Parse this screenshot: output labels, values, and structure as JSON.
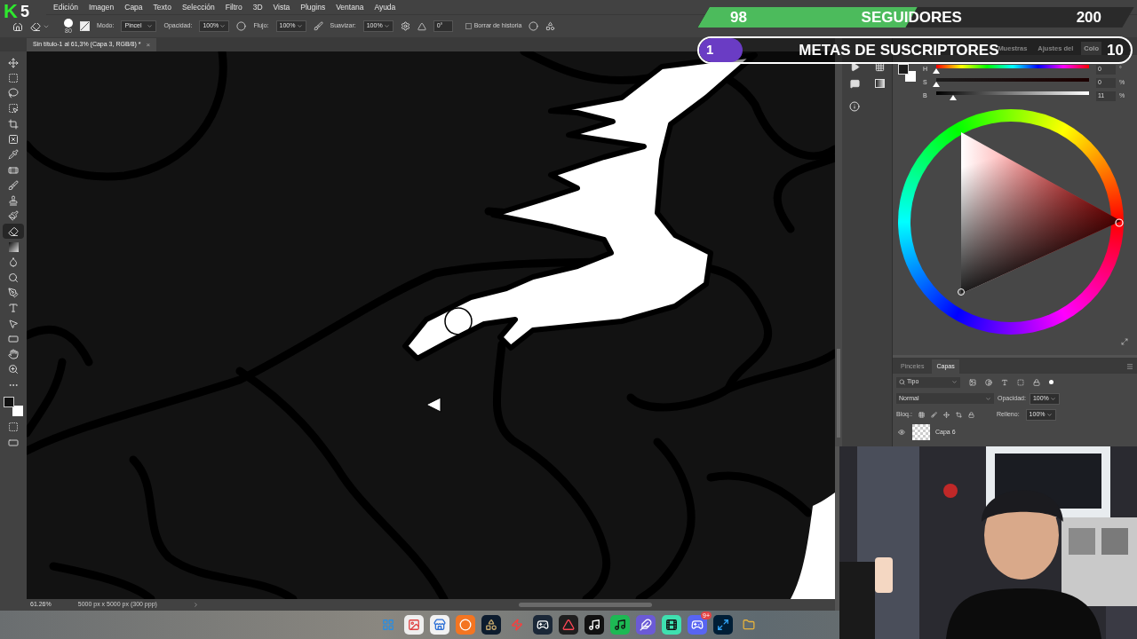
{
  "overlay_logo": {
    "letter": "K",
    "number": "5"
  },
  "menu": [
    "Edición",
    "Imagen",
    "Capa",
    "Texto",
    "Selección",
    "Filtro",
    "3D",
    "Vista",
    "Plugins",
    "Ventana",
    "Ayuda"
  ],
  "options_bar": {
    "brush_size": "80",
    "mode_label": "Modo:",
    "mode_value": "Pincel",
    "opacity_label": "Opacidad:",
    "opacity_value": "100%",
    "flow_label": "Flujo:",
    "flow_value": "100%",
    "smoothing_label": "Suavizar:",
    "smoothing_value": "100%",
    "angle_value": "0°",
    "erase_history": {
      "label": "Borrar de historia",
      "checked": false
    }
  },
  "document_tab": {
    "title": "Sin título-1 al 61,3% (Capa 3, RGB/8) *",
    "close": "×"
  },
  "toolbar": {
    "tools": [
      {
        "kind": "move",
        "selected": false
      },
      {
        "kind": "marquee",
        "selected": false
      },
      {
        "kind": "lasso",
        "selected": false
      },
      {
        "kind": "object-select",
        "selected": false
      },
      {
        "kind": "crop",
        "selected": false
      },
      {
        "kind": "frame",
        "selected": false
      },
      {
        "kind": "eyedropper",
        "selected": false
      },
      {
        "kind": "healing",
        "selected": false
      },
      {
        "kind": "brush",
        "selected": false
      },
      {
        "kind": "stamp",
        "selected": false
      },
      {
        "kind": "history-brush",
        "selected": false
      },
      {
        "kind": "eraser",
        "selected": true
      },
      {
        "kind": "gradient",
        "selected": false
      },
      {
        "kind": "blur",
        "selected": false
      },
      {
        "kind": "dodge",
        "selected": false
      },
      {
        "kind": "pen",
        "selected": false
      },
      {
        "kind": "type",
        "selected": false
      },
      {
        "kind": "path-select",
        "selected": false
      },
      {
        "kind": "rectangle",
        "selected": false
      },
      {
        "kind": "hand",
        "selected": false
      },
      {
        "kind": "zoom",
        "selected": false
      },
      {
        "kind": "more",
        "selected": false
      }
    ]
  },
  "followers_goal": {
    "current": "98",
    "title": "SEGUIDORES",
    "target": "200",
    "level": 0.49
  },
  "subscriber_goal": {
    "current": "1",
    "title": "METAS DE SUSCRIPTORES",
    "target": "10",
    "level": 0.1
  },
  "color_panel": {
    "tabs": [
      {
        "label": "Muestras",
        "selected": false
      },
      {
        "label": "Ajustes del",
        "selected": false
      },
      {
        "label": "Colo",
        "selected": true
      }
    ],
    "sliders": [
      {
        "kind": "hue",
        "label": "H",
        "value": "0",
        "unit": "°",
        "level": 0
      },
      {
        "kind": "saturation",
        "label": "S",
        "value": "0",
        "unit": "%",
        "level": 0
      },
      {
        "kind": "brightness",
        "label": "B",
        "value": "11",
        "unit": "%",
        "level": 0.11
      }
    ]
  },
  "layers_panel": {
    "tabs": [
      {
        "label": "Pinceles",
        "selected": false
      },
      {
        "label": "Capas",
        "selected": true
      }
    ],
    "filter": "Tipo",
    "blend_mode": "Normal",
    "opacity_label": "Opacidad:",
    "opacity_value": "100%",
    "lock_label": "Bloq.:",
    "fill_label": "Relleno:",
    "fill_value": "100%",
    "layers": [
      {
        "name": "Capa 6",
        "visible": true
      }
    ]
  },
  "status_bar": {
    "zoom": "61.26%",
    "doc_size": "5000 px x 5000 px (300 ppp)"
  },
  "taskbar": {
    "badge": "9+"
  }
}
